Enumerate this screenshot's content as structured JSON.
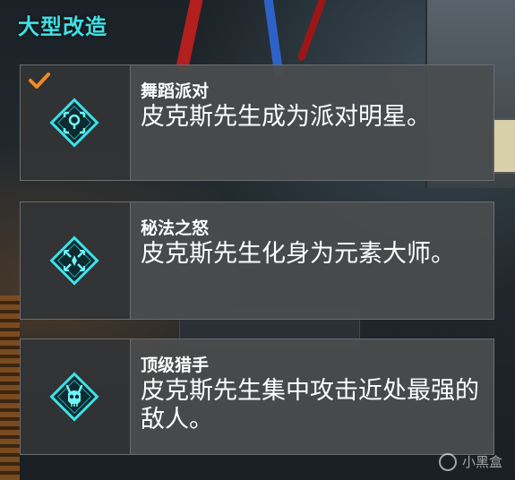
{
  "header": {
    "title": "大型改造"
  },
  "colors": {
    "accent": "#3fe0e6",
    "check": "#f08a24",
    "card_bg": "#4a4c4d"
  },
  "upgrades": [
    {
      "title": "舞蹈派对",
      "description": "皮克斯先生成为派对明星。",
      "icon": "dance-party-icon",
      "selected": true
    },
    {
      "title": "秘法之怒",
      "description": "皮克斯先生化身为元素大师。",
      "icon": "arcane-fury-icon",
      "selected": false
    },
    {
      "title": "顶级猎手",
      "description": "皮克斯先生集中攻击近处最强的敌人。",
      "icon": "skull-hunter-icon",
      "selected": false
    }
  ],
  "watermark": {
    "text": "小黑盒"
  }
}
